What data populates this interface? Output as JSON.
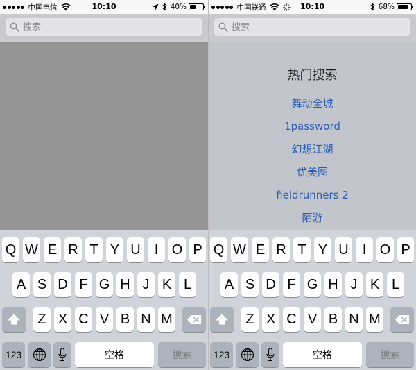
{
  "left": {
    "status": {
      "carrier": "中国电信",
      "time": "10:10",
      "battery": "40%",
      "battery_level": 0.4
    },
    "search": {
      "placeholder": "搜索"
    },
    "keyboard": {
      "row1": [
        "Q",
        "W",
        "E",
        "R",
        "T",
        "Y",
        "U",
        "I",
        "O",
        "P"
      ],
      "row2": [
        "A",
        "S",
        "D",
        "F",
        "G",
        "H",
        "J",
        "K",
        "L"
      ],
      "row3": [
        "Z",
        "X",
        "C",
        "V",
        "B",
        "N",
        "M"
      ],
      "numbers_key": "123",
      "space_key": "空格",
      "search_key": "搜索"
    }
  },
  "right": {
    "status": {
      "carrier": "中国联通",
      "time": "10:10",
      "battery": "68%",
      "battery_level": 0.68
    },
    "search": {
      "placeholder": "搜索"
    },
    "hot": {
      "title": "热门搜索",
      "items": [
        "舞动全城",
        "1password",
        "幻想江湖",
        "优美图",
        "fieldrunners 2",
        "陌游"
      ]
    },
    "keyboard": {
      "row1": [
        "Q",
        "W",
        "E",
        "R",
        "T",
        "Y",
        "U",
        "I",
        "O",
        "P"
      ],
      "row2": [
        "A",
        "S",
        "D",
        "F",
        "G",
        "H",
        "J",
        "K",
        "L"
      ],
      "row3": [
        "Z",
        "X",
        "C",
        "V",
        "B",
        "N",
        "M"
      ],
      "numbers_key": "123",
      "space_key": "空格",
      "search_key": "搜索"
    }
  },
  "icons": {
    "wifi": "wifi-icon",
    "location": "location-arrow-icon",
    "bluetooth": "bluetooth-icon",
    "activity": "activity-spinner-icon",
    "search": "search-icon",
    "shift": "shift-icon",
    "delete": "delete-icon",
    "globe": "globe-icon",
    "mic": "microphone-icon"
  },
  "colors": {
    "link": "#2a5db6",
    "dim_overlay": "#959595",
    "keyboard_bg": "#d0d3d9"
  }
}
